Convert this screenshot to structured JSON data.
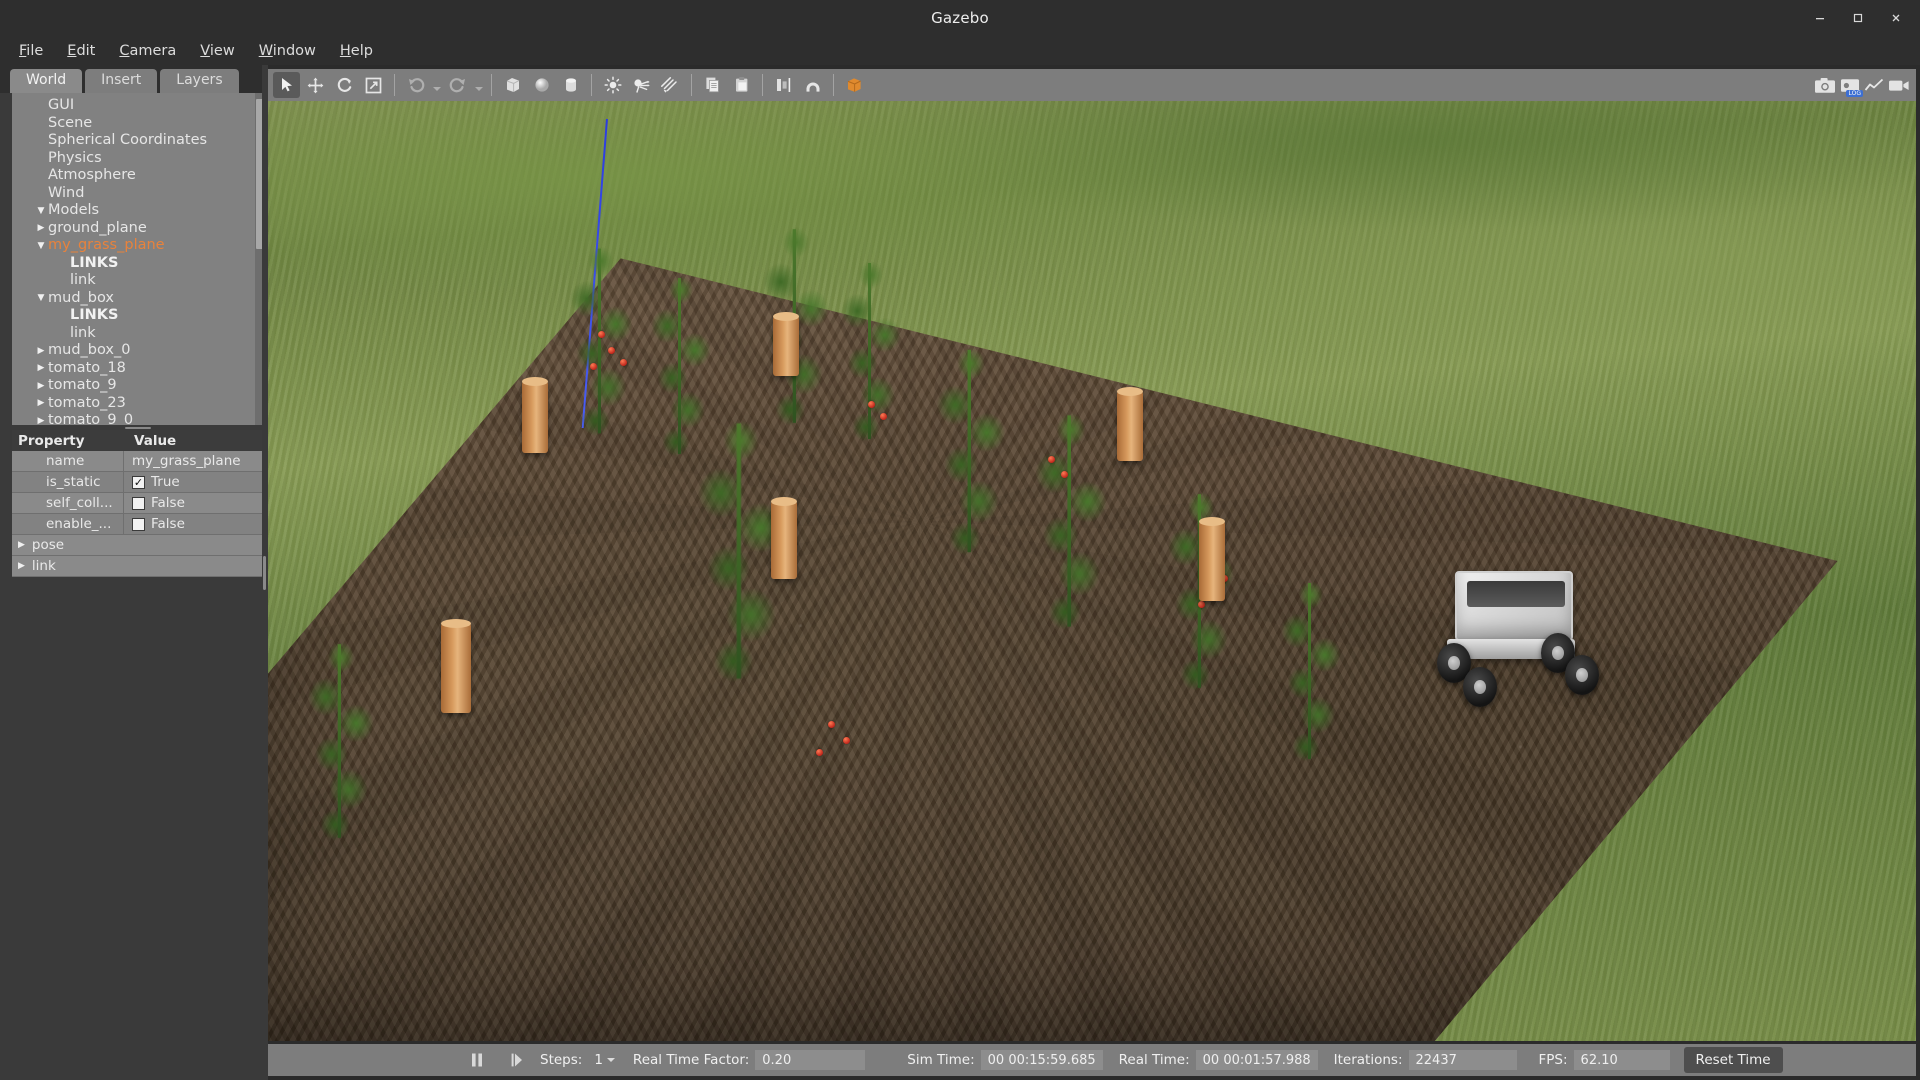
{
  "window": {
    "title": "Gazebo",
    "minimize_label": "—",
    "maximize_label": "❐",
    "close_label": "✕"
  },
  "menubar": {
    "items": [
      {
        "label": "File",
        "mnemonic": "F"
      },
      {
        "label": "Edit",
        "mnemonic": "E"
      },
      {
        "label": "Camera",
        "mnemonic": "C"
      },
      {
        "label": "View",
        "mnemonic": "V"
      },
      {
        "label": "Window",
        "mnemonic": "W"
      },
      {
        "label": "Help",
        "mnemonic": "H"
      }
    ]
  },
  "left_panel": {
    "tabs": [
      {
        "label": "World",
        "active": true
      },
      {
        "label": "Insert",
        "active": false
      },
      {
        "label": "Layers",
        "active": false
      }
    ],
    "tree": [
      {
        "label": "GUI",
        "indent": 1,
        "arrow": "none",
        "selected": false,
        "bold": false
      },
      {
        "label": "Scene",
        "indent": 1,
        "arrow": "none",
        "selected": false,
        "bold": false
      },
      {
        "label": "Spherical Coordinates",
        "indent": 1,
        "arrow": "none",
        "selected": false,
        "bold": false
      },
      {
        "label": "Physics",
        "indent": 1,
        "arrow": "none",
        "selected": false,
        "bold": false
      },
      {
        "label": "Atmosphere",
        "indent": 1,
        "arrow": "none",
        "selected": false,
        "bold": false
      },
      {
        "label": "Wind",
        "indent": 1,
        "arrow": "none",
        "selected": false,
        "bold": false
      },
      {
        "label": "Models",
        "indent": 0,
        "arrow": "down",
        "selected": false,
        "bold": false
      },
      {
        "label": "ground_plane",
        "indent": 1,
        "arrow": "right",
        "selected": false,
        "bold": false
      },
      {
        "label": "my_grass_plane",
        "indent": 1,
        "arrow": "down",
        "selected": true,
        "bold": false
      },
      {
        "label": "LINKS",
        "indent": 2,
        "arrow": "none",
        "selected": false,
        "bold": true
      },
      {
        "label": "link",
        "indent": 2,
        "arrow": "none",
        "selected": false,
        "bold": false
      },
      {
        "label": "mud_box",
        "indent": 1,
        "arrow": "down",
        "selected": false,
        "bold": false
      },
      {
        "label": "LINKS",
        "indent": 2,
        "arrow": "none",
        "selected": false,
        "bold": true
      },
      {
        "label": "link",
        "indent": 2,
        "arrow": "none",
        "selected": false,
        "bold": false
      },
      {
        "label": "mud_box_0",
        "indent": 1,
        "arrow": "right",
        "selected": false,
        "bold": false
      },
      {
        "label": "tomato_18",
        "indent": 1,
        "arrow": "right",
        "selected": false,
        "bold": false
      },
      {
        "label": "tomato_9",
        "indent": 1,
        "arrow": "right",
        "selected": false,
        "bold": false
      },
      {
        "label": "tomato_23",
        "indent": 1,
        "arrow": "right",
        "selected": false,
        "bold": false
      },
      {
        "label": "tomato_9_0",
        "indent": 1,
        "arrow": "right",
        "selected": false,
        "bold": false
      }
    ],
    "property_table": {
      "headers": {
        "property": "Property",
        "value": "Value"
      },
      "rows": [
        {
          "key": "name",
          "value": "my_grass_plane",
          "type": "text"
        },
        {
          "key": "is_static",
          "value": "True",
          "type": "checkbox",
          "checked": true
        },
        {
          "key": "self_coll...",
          "value": "False",
          "type": "checkbox",
          "checked": false
        },
        {
          "key": "enable_...",
          "value": "False",
          "type": "checkbox",
          "checked": false
        }
      ],
      "expanders": [
        {
          "label": "pose"
        },
        {
          "label": "link"
        }
      ]
    }
  },
  "toolbar": {
    "buttons": [
      {
        "name": "select-mode",
        "icon": "cursor-arrow-icon",
        "active": true,
        "dim": false
      },
      {
        "name": "translate-mode",
        "icon": "move-arrows-icon",
        "active": false,
        "dim": false
      },
      {
        "name": "rotate-mode",
        "icon": "rotate-icon",
        "active": false,
        "dim": false
      },
      {
        "name": "scale-mode",
        "icon": "scale-icon",
        "active": false,
        "dim": false
      },
      {
        "name": "undo",
        "icon": "undo-arrow-icon",
        "active": false,
        "dim": true
      },
      {
        "name": "redo",
        "icon": "redo-arrow-icon",
        "active": false,
        "dim": true
      },
      {
        "name": "insert-box",
        "icon": "box-icon",
        "active": false,
        "dim": false
      },
      {
        "name": "insert-sphere",
        "icon": "sphere-icon",
        "active": false,
        "dim": false
      },
      {
        "name": "insert-cylinder",
        "icon": "cylinder-icon",
        "active": false,
        "dim": false
      },
      {
        "name": "point-light",
        "icon": "point-light-icon",
        "active": false,
        "dim": false
      },
      {
        "name": "spot-light",
        "icon": "spot-light-icon",
        "active": false,
        "dim": false
      },
      {
        "name": "directional-light",
        "icon": "directional-light-icon",
        "active": false,
        "dim": false
      },
      {
        "name": "copy",
        "icon": "copy-icon",
        "active": false,
        "dim": false
      },
      {
        "name": "paste",
        "icon": "paste-icon",
        "active": false,
        "dim": false
      },
      {
        "name": "align",
        "icon": "align-icon",
        "active": false,
        "dim": false
      },
      {
        "name": "snap",
        "icon": "snap-magnet-icon",
        "active": false,
        "dim": false
      },
      {
        "name": "view-angle",
        "icon": "view-cube-icon",
        "active": false,
        "dim": false
      }
    ],
    "overlay_icons": [
      {
        "name": "screenshot-icon"
      },
      {
        "name": "log-record-icon",
        "badge": "LOG"
      },
      {
        "name": "plot-icon"
      },
      {
        "name": "video-record-icon"
      }
    ]
  },
  "status_bar": {
    "pause_icon": "pause-icon",
    "step_icon": "step-forward-icon",
    "steps_label": "Steps:",
    "steps_value": "1",
    "real_time_factor_label": "Real Time Factor:",
    "real_time_factor_value": "0.20",
    "sim_time_label": "Sim Time:",
    "sim_time_value": "00 00:15:59.685",
    "real_time_label": "Real Time:",
    "real_time_value": "00 00:01:57.988",
    "iterations_label": "Iterations:",
    "iterations_value": "22437",
    "fps_label": "FPS:",
    "fps_value": "62.10",
    "reset_button": "Reset Time"
  },
  "scene": {
    "description": "Gazebo 3D viewport: tomato field simulation with mud plot, tomato plants, wooden posts and a white four-wheeled agricultural robot",
    "selection_axis_color": "#3344e8",
    "colors": {
      "grass": "#6e8440",
      "soil": "#5b4733",
      "post": "#d79a5d",
      "tomato_red": "#c0261b",
      "robot_body": "#e8e8e8"
    }
  }
}
